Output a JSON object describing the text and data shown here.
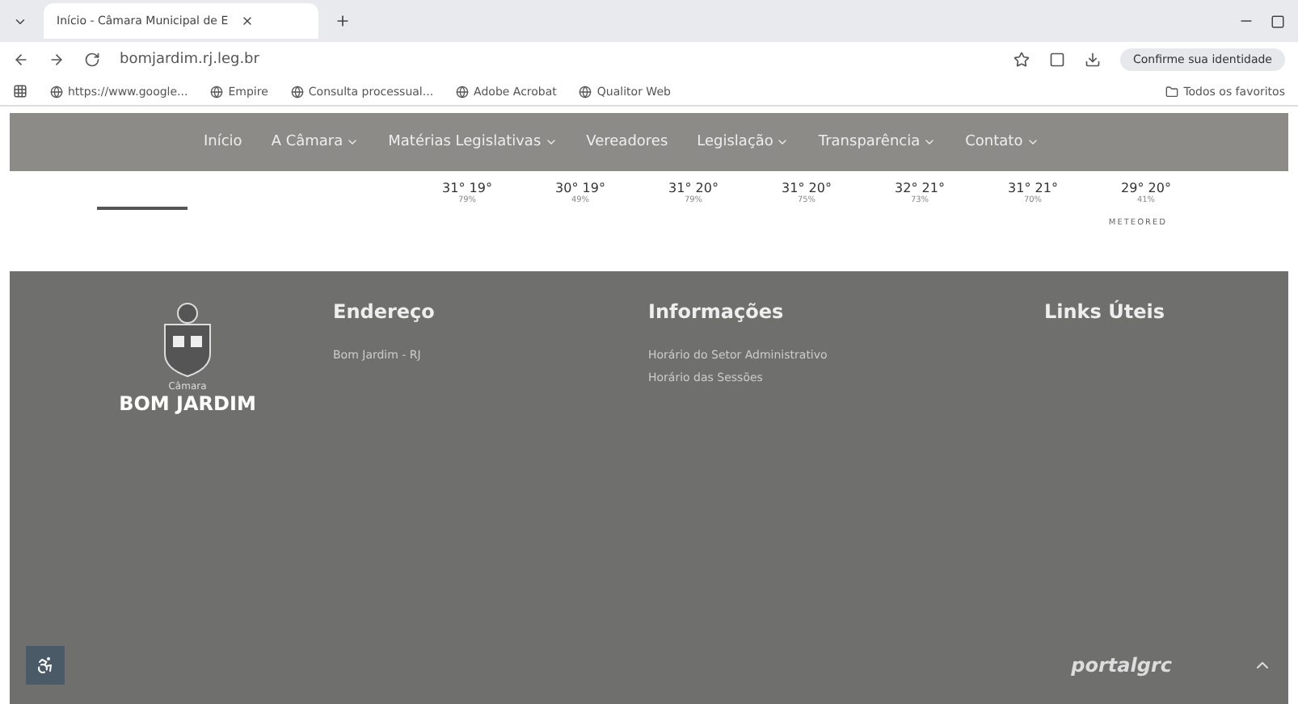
{
  "browser": {
    "tab": {
      "title": "Início - Câmara Municipal de E"
    },
    "url": "bomjardim.rj.leg.br",
    "profile": "Confirme sua identidade",
    "bookmarks": [
      "https://www.google...",
      "Empire",
      "Consulta processual...",
      "Adobe Acrobat",
      "Qualitor Web"
    ],
    "all_bookmarks": "Todos os favoritos"
  },
  "nav": [
    {
      "label": "Início",
      "dropdown": false
    },
    {
      "label": "A Câmara",
      "dropdown": true
    },
    {
      "label": "Matérias Legislativas",
      "dropdown": true
    },
    {
      "label": "Vereadores",
      "dropdown": false
    },
    {
      "label": "Legislação",
      "dropdown": true
    },
    {
      "label": "Transparência",
      "dropdown": true
    },
    {
      "label": "Contato",
      "dropdown": true
    }
  ],
  "weather": {
    "days": [
      {
        "temps": "31° 19°",
        "humidity": "79%"
      },
      {
        "temps": "30° 19°",
        "humidity": "49%"
      },
      {
        "temps": "31° 20°",
        "humidity": "79%"
      },
      {
        "temps": "31° 20°",
        "humidity": "75%"
      },
      {
        "temps": "32° 21°",
        "humidity": "73%"
      },
      {
        "temps": "31° 21°",
        "humidity": "70%"
      },
      {
        "temps": "29° 20°",
        "humidity": "41%"
      }
    ],
    "source": "METEORED"
  },
  "footer": {
    "logo": {
      "caption": "Câmara",
      "name": "BOM JARDIM"
    },
    "columns": [
      {
        "title": "Endereço",
        "lines": [
          "Bom Jardim - RJ"
        ]
      },
      {
        "title": "Informações",
        "lines": [
          "Horário do Setor Administrativo",
          "Horário das Sessões"
        ]
      },
      {
        "title": "Links Úteis"
      }
    ],
    "brand": "portalgrc"
  }
}
